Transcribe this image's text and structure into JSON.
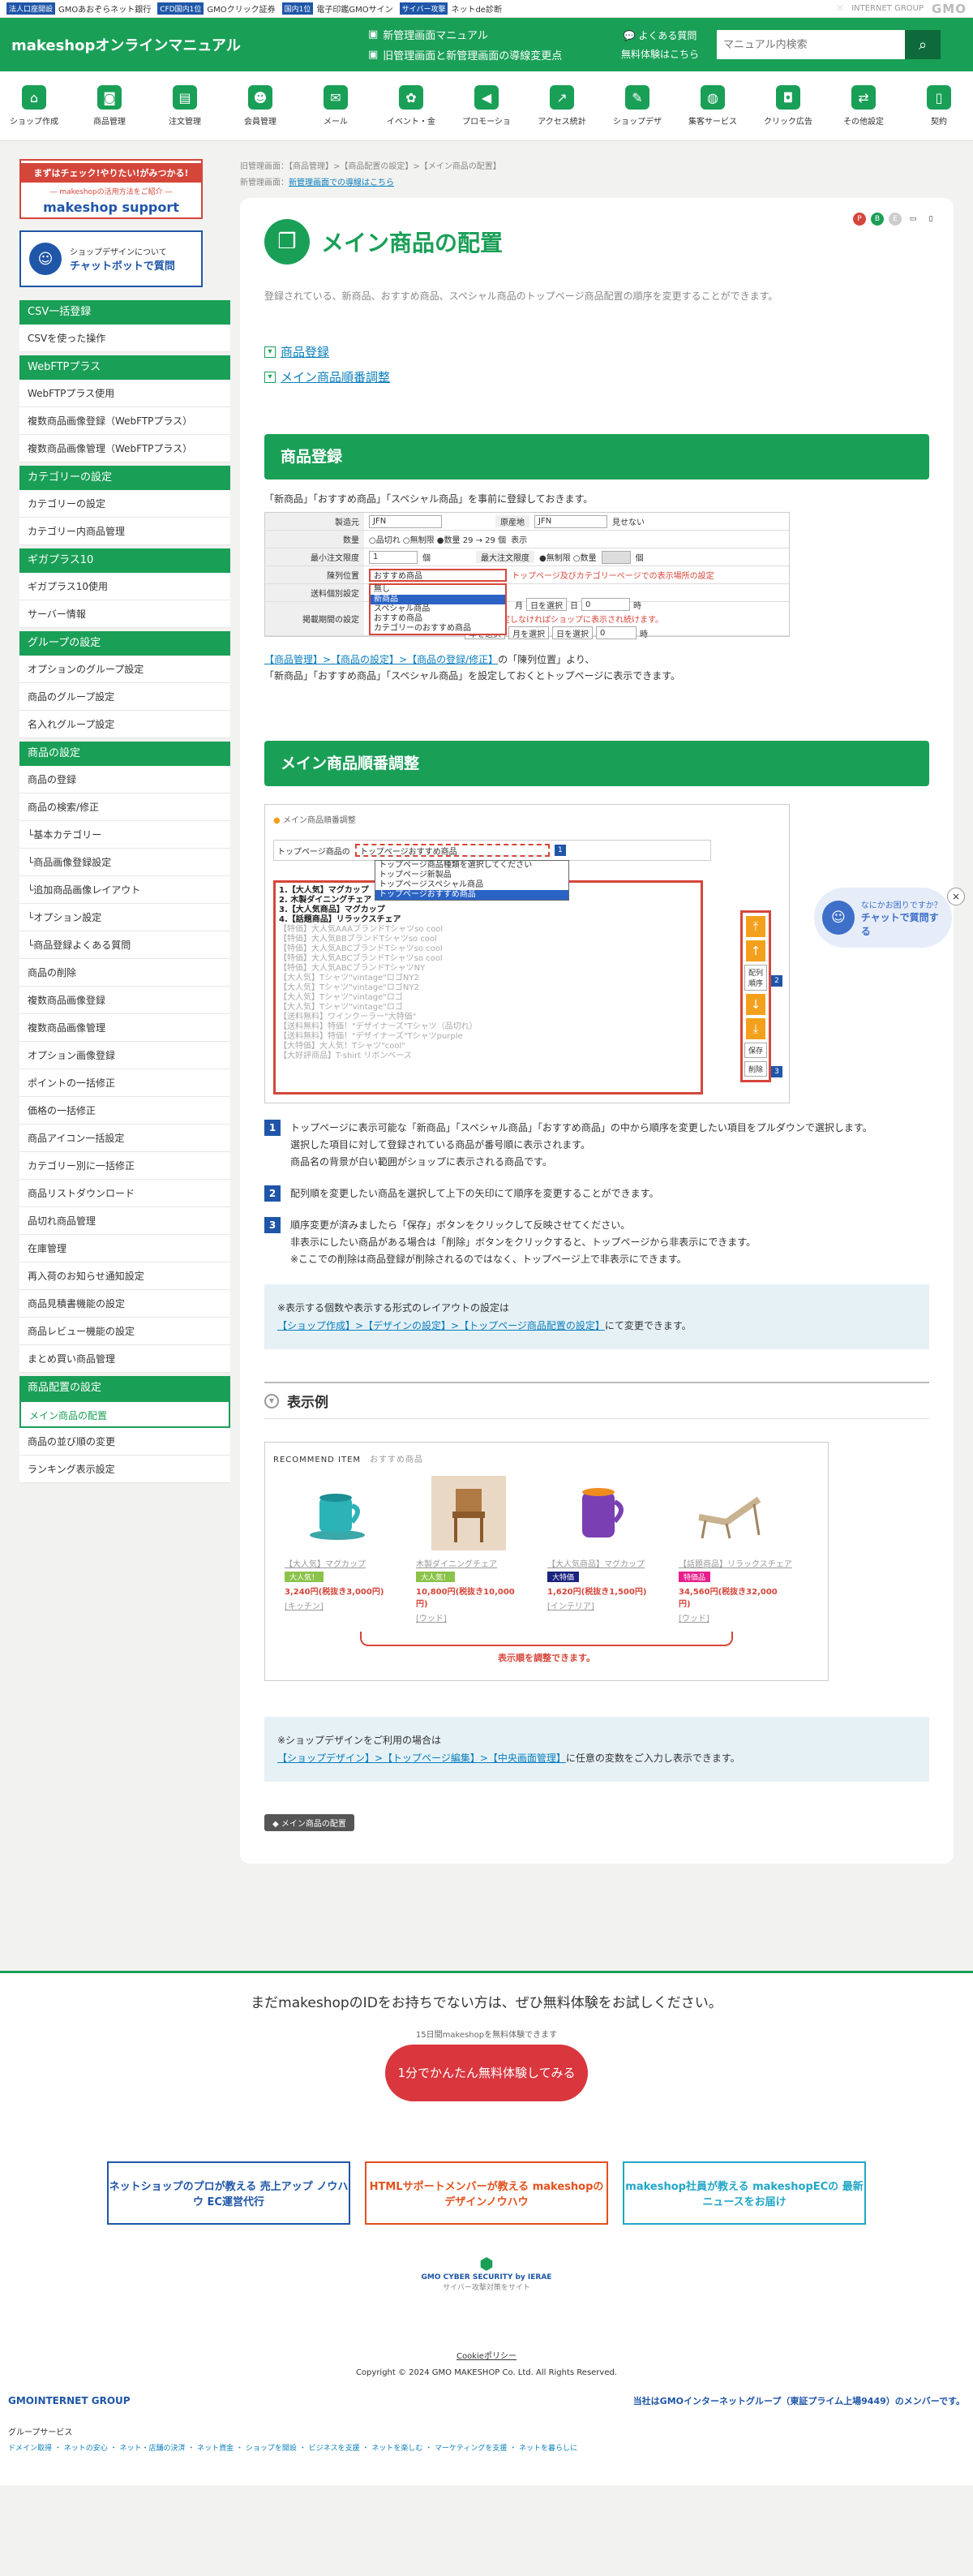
{
  "topbar": {
    "items": [
      {
        "tag": "法人口座開設",
        "text": "GMOあおぞらネット銀行"
      },
      {
        "tag": "CFD国内1位",
        "text": "GMOクリック証券"
      },
      {
        "tag": "国内1位",
        "text": "電子印鑑GMOサイン"
      },
      {
        "tag": "サイバー攻撃",
        "text": "ネットde診断"
      }
    ],
    "brand": "GMO",
    "brand_small": "INTERNET GROUP"
  },
  "header": {
    "brand": "makeshopオンラインマニュアル",
    "link1": "新管理画面マニュアル",
    "link2": "旧管理画面と新管理画面の導線変更点",
    "faq": "よくある質問",
    "trial": "無料体験はこちら",
    "search_placeholder": "マニュアル内検索",
    "search_icon": "search-icon"
  },
  "nav": [
    {
      "label": "ショップ作成",
      "icon": "shop-icon"
    },
    {
      "label": "商品管理",
      "icon": "basket-icon"
    },
    {
      "label": "注文管理",
      "icon": "clipboard-icon"
    },
    {
      "label": "会員管理",
      "icon": "members-icon"
    },
    {
      "label": "メール",
      "icon": "mail-icon"
    },
    {
      "label": "イベント・金",
      "icon": "gift-icon"
    },
    {
      "label": "プロモーショ",
      "icon": "megaphone-icon"
    },
    {
      "label": "アクセス統計",
      "icon": "chart-icon"
    },
    {
      "label": "ショップデザ",
      "icon": "palette-icon"
    },
    {
      "label": "集客サービス",
      "icon": "globe-icon"
    },
    {
      "label": "クリック広告",
      "icon": "mouse-icon"
    },
    {
      "label": "その他設定",
      "icon": "arrows-icon"
    },
    {
      "label": "契約",
      "icon": "phone-icon"
    }
  ],
  "side": {
    "banner1_top": "まずはチェック!やりたい!がみつかる!",
    "banner1_sub": "― makeshopの活用方法をご紹介 ―",
    "banner1_logo": "makeshop support",
    "banner2_line1": "ショップデザインについて",
    "banner2_line2": "チャットボットで質問",
    "groups": [
      {
        "title": "CSV一括登録",
        "items": [
          "CSVを使った操作"
        ]
      },
      {
        "title": "WebFTPプラス",
        "items": [
          "WebFTPプラス使用",
          "複数商品画像登録（WebFTPプラス）",
          "複数商品画像管理（WebFTPプラス）"
        ]
      },
      {
        "title": "カテゴリーの設定",
        "items": [
          "カテゴリーの設定",
          "カテゴリー内商品管理"
        ]
      },
      {
        "title": "ギガプラス10",
        "items": [
          "ギガプラス10使用",
          "サーバー情報"
        ]
      },
      {
        "title": "グループの設定",
        "items": [
          "オプションのグループ設定",
          "商品のグループ設定",
          "名入れグループ設定"
        ]
      },
      {
        "title": "商品の設定",
        "items": [
          "商品の登録",
          "商品の検索/修正",
          "└基本カテゴリー",
          "└商品画像登録設定",
          "└追加商品画像レイアウト",
          "└オプション設定",
          "└商品登録よくある質問",
          "商品の削除",
          "複数商品画像登録",
          "複数商品画像管理",
          "オプション画像登録",
          "ポイントの一括修正",
          "価格の一括修正",
          "商品アイコン一括設定",
          "カテゴリー別に一括修正",
          "商品リストダウンロード",
          "品切れ商品管理",
          "在庫管理",
          "再入荷のお知らせ通知設定",
          "商品見積書機能の設定",
          "商品レビュー機能の設定",
          "まとめ買い商品管理"
        ]
      },
      {
        "title": "商品配置の設定",
        "items": [
          "メイン商品の配置",
          "商品の並び順の変更",
          "ランキング表示設定"
        ]
      }
    ],
    "active": "メイン商品の配置"
  },
  "crumb": {
    "line1": "旧管理画面：【商品管理】>【商品配置の設定】>【メイン商品の配置】",
    "line2_label": "新管理画面：",
    "line2_link": "新管理画面での導線はこちら"
  },
  "page": {
    "title": "メイン商品の配置",
    "title_icon": "box-icon",
    "badges": [
      "P",
      "B",
      "E",
      "pc-icon",
      "mobile-icon"
    ],
    "lead": "登録されている、新商品、おすすめ商品、スペシャル商品のトップページ商品配置の順序を変更することができます。",
    "toc": [
      "商品登録",
      "メイン商品順番調整"
    ],
    "sec1": {
      "title": "商品登録",
      "text": "「新商品」「おすすめ商品」「スペシャル商品」を事前に登録しておきます。",
      "form": {
        "r1_label": "製造元",
        "r1_val": "JFN",
        "r1_label2": "原産地",
        "r1_val2": "JFN",
        "r1_opt": "見せない",
        "r2_label": "数量",
        "r2_opts": "○品切れ ○無制限 ●数量 29 → 29 個",
        "r2_opt2": "表示",
        "r3_label": "最小注文限度",
        "r3_val": "1",
        "r3_unit": "個",
        "r3_label2": "最大注文限度",
        "r3_opts": "●無制限 ○数量",
        "r3_unit2": "個",
        "r4_label": "陳列位置",
        "r4_sel": "おすすめ商品",
        "r4_note": "トップページ及びカテゴリーページでの表示場所の設定",
        "r5_label": "送料個別設定",
        "r6_label": "掲載期間の設定",
        "r6_note": "日付を設定しなければショップに表示され続けます。",
        "dropdown": [
          "無し",
          "新商品",
          "スペシャル商品",
          "おすすめ商品",
          "カテゴリーのおすすめ商品"
        ],
        "m": "月",
        "d": "日",
        "h": "時",
        "month_sel": "日を選択",
        "year_sel": "年を選択",
        "mon_sel": "月を選択",
        "zero": "0"
      },
      "desc_link": "【商品管理】>【商品の設定】>【商品の登録/修正】",
      "desc_rest": "の「陳列位置」より、",
      "desc2": "「新商品」「おすすめ商品」「スペシャル商品」を設定しておくとトップページに表示できます。"
    },
    "sec2": {
      "title": "メイン商品順番調整",
      "shot": {
        "head": "メイン商品順番調整",
        "label": "トップページ商品の",
        "select": "トップページおすすめ商品",
        "options": [
          "トップページ商品種類を選択してください",
          "トップページ新製品",
          "トップページスペシャル商品",
          "トップページおすすめ商品"
        ],
        "list_bold": [
          "1.【大人気】マグカップ",
          "2. 木製ダイニングチェア",
          "3.【大人気商品】マグカップ",
          "4.【話題商品】リラックスチェア"
        ],
        "list_gray": [
          "【特価】大人気AAAブランドTシャツso cool",
          "【特価】大人気BBブランドTシャツso cool",
          "【特価】大人気ABCブランドTシャツso cool",
          "【特価】大人気ABCブランドTシャツso cool",
          "【特価】大人気ABCブランドTシャツNY",
          "【大人気】Tシャツ\"vintage\"ロゴNY2",
          "【大人気】Tシャツ\"vintage\"ロゴNY2",
          "【大人気】Tシャツ\"vintage\"ロゴ",
          "【大人気】Tシャツ\"vintage\"ロゴ",
          "【送料無料】ワインクーラー\"大特価\"",
          "【送料無料】特価！\"デザイナーズ\"Tシャツ（品切れ）",
          "【送料無料】特価！\"デザイナーズ\"Tシャツpurple",
          "【大特価】大人気！Tシャツ\"cool\"",
          "【大好評商品】T-shirt リボンベース"
        ],
        "btn_order": "配列順序",
        "btn_save": "保存",
        "btn_delete": "削除",
        "n1": "1",
        "n2": "2",
        "n3": "3",
        "arrow_top": "top-arrow-icon",
        "arrow_up": "up-arrow-icon",
        "arrow_down": "down-arrow-icon",
        "arrow_bottom": "bottom-arrow-icon"
      },
      "steps": [
        {
          "n": "1",
          "lines": [
            "トップページに表示可能な「新商品」「スペシャル商品」「おすすめ商品」の中から順序を変更したい項目をプルダウンで選択します。",
            "選択した項目に対して登録されている商品が番号順に表示されます。",
            "商品名の背景が白い範囲がショップに表示される商品です。"
          ]
        },
        {
          "n": "2",
          "lines": [
            "配列順を変更したい商品を選択して上下の矢印にて順序を変更することができます。"
          ]
        },
        {
          "n": "3",
          "lines": [
            "順序変更が済みましたら「保存」ボタンをクリックして反映させてください。",
            "非表示にしたい商品がある場合は「削除」ボタンをクリックすると、トップページから非表示にできます。",
            "※ここでの削除は商品登録が削除されるのではなく、トップページ上で非表示にできます。"
          ]
        }
      ],
      "note_line1": "※表示する個数や表示する形式のレイアウトの設定は",
      "note_link": "【ショップ作成】>【デザインの設定】>【トップページ商品配置の設定】",
      "note_rest": "にて変更できます。"
    },
    "sec3": {
      "title": "表示例",
      "rec_title": "RECOMMEND ITEM",
      "rec_sub": "おすすめ商品",
      "products": [
        {
          "name": "【大人気】マグカップ",
          "tag": "大人気！",
          "price": "3,240円(税抜き3,000円)",
          "cat": "[キッチン]",
          "tagcolor": "#8bc34a",
          "img": "mug-icon"
        },
        {
          "name": "木製ダイニングチェア",
          "tag": "大人気！",
          "price": "10,800円(税抜き10,000円)",
          "cat": "[ウッド]",
          "tagcolor": "#8bc34a",
          "img": "chair-icon"
        },
        {
          "name": "【大人気商品】マグカップ",
          "tag": "大特価",
          "price": "1,620円(税抜き1,500円)",
          "cat": "[インテリア]",
          "tagcolor": "#1a237e",
          "img": "purple-mug-icon"
        },
        {
          "name": "【話題商品】リラックスチェア",
          "tag": "特価品",
          "price": "34,560円(税抜き32,000円)",
          "cat": "[ウッド]",
          "tagcolor": "#e91e8c",
          "img": "lounge-chair-icon"
        }
      ],
      "brace_text": "表示順を調整できます。"
    },
    "sec4": {
      "line1": "※ショップデザインをご利用の場合は",
      "link": "【ショップデザイン】>【トップページ編集】>【中央画面管理】",
      "rest": "に任意の変数をご入力し表示できます。"
    },
    "tag": "メイン商品の配置"
  },
  "chatbot": {
    "q": "なにかお困りですか？",
    "a": "チャットで質問する",
    "close": "×"
  },
  "footer": {
    "q": "まだmakeshopのIDをお持ちでない方は、ぜひ無料体験をお試しください。",
    "small": "15日間makeshopを無料体験できます",
    "cta": "1分でかんたん無料体験してみる",
    "banners": [
      "ネットショップのプロが教える 売上アップ ノウハウ EC運営代行",
      "HTMLサポートメンバーが教える makeshopの デザインノウハウ",
      "makeshop社員が教える makeshopECの 最新ニュースをお届け"
    ],
    "gmo_mark": "GMO CYBER SECURITY by IERAE",
    "gmo_small": "サイバー攻撃対策をサイト",
    "cookie": "Cookieポリシー",
    "copy": "Copyright © 2024 GMO MAKESHOP Co. Ltd. All Rights Reserved.",
    "group": "GMOINTERNET GROUP",
    "member": "当社はGMOインターネットグループ（東証プライム上場9449）のメンバーです。",
    "svc_title": "グループサービス",
    "svc_links": "ドメイン取得 ・ ネットの安心 ・ ネット・店舗の決済 ・ ネット資金 ・ ショップを開設 ・ ビジネスを支援 ・ ネットを楽しむ ・ マーケティングを支援 ・ ネットを暮らしに"
  }
}
